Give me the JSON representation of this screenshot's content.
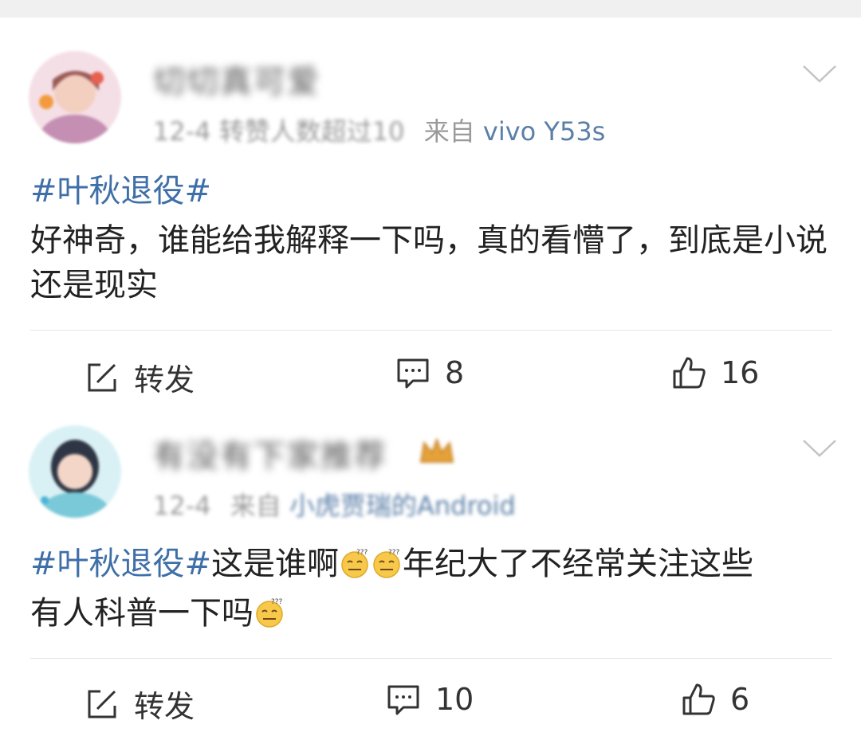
{
  "posts": [
    {
      "username": "切切真可爱",
      "date": "12-4",
      "extra": "转赞人数超过10",
      "from_label": "来自",
      "source": "vivo Y53s",
      "topic": "#叶秋退役#",
      "text": "好神奇，谁能给我解释一下吗，真的看懵了，到底是小说还是现实",
      "actions": {
        "repost_label": "转发",
        "comments": "8",
        "likes": "16"
      }
    },
    {
      "username": "有没有下家推荐",
      "date": "12-4",
      "from_label": "来自",
      "source": "小虎贾瑞的Android",
      "topic": "#叶秋退役#",
      "text_part1": "这是谁啊",
      "text_part2": "年纪大了不经常关注这些",
      "text_part3": "有人科普一下吗",
      "actions": {
        "repost_label": "转发",
        "comments": "10",
        "likes": "6"
      }
    }
  ],
  "icons": {
    "repost": "edit-square-icon",
    "comment": "comment-bubble-icon",
    "like": "thumbs-up-icon",
    "more": "chevron-down-icon",
    "emoji": "thinking-sweat-emoji-icon",
    "badge": "crown-icon"
  },
  "colors": {
    "topic": "#3f6fa8",
    "meta": "#9a9a9a",
    "source": "#5b7fa8"
  }
}
